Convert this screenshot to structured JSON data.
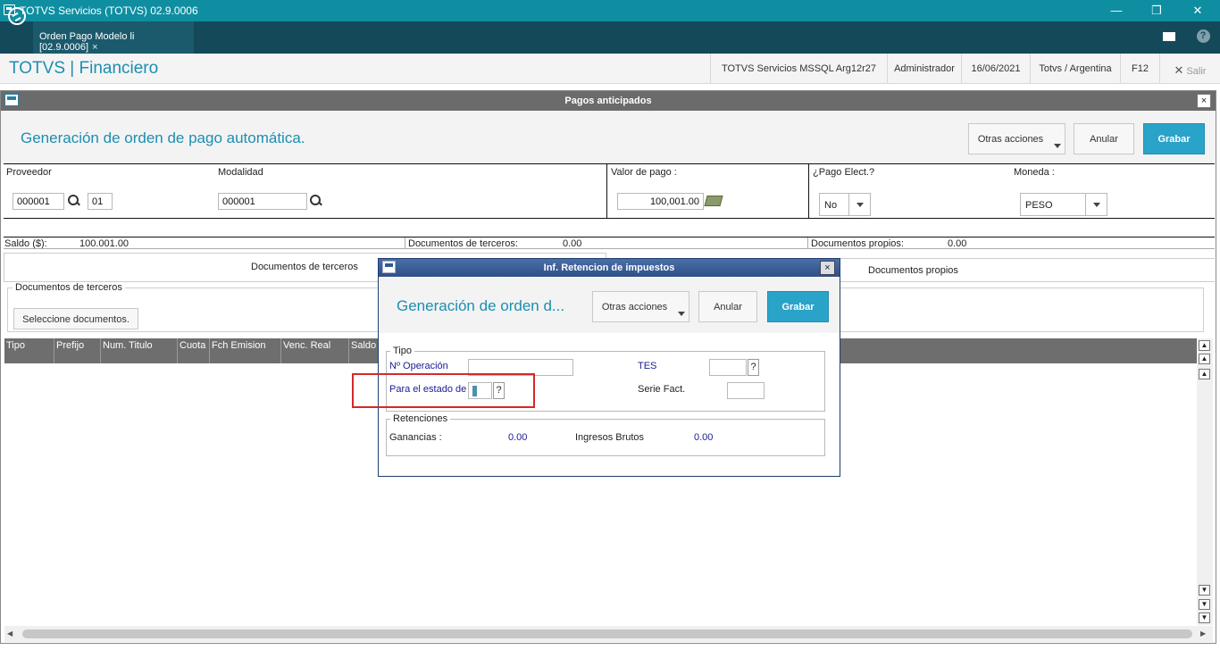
{
  "window": {
    "title": "TOTVS Servicios (TOTVS) 02.9.0006",
    "minimize": "—",
    "restore": "❐",
    "close": "✕"
  },
  "tabbar": {
    "tab_label": "Orden Pago Modelo li [02.9.0006]",
    "tab_close": "×",
    "help": "?"
  },
  "header": {
    "brand": "TOTVS | Financiero",
    "server": "TOTVS Servicios MSSQL Arg12r27",
    "user": "Administrador",
    "date": "16/06/2021",
    "company": "Totvs / Argentina",
    "key": "F12",
    "exit_icon": "✕",
    "exit": "Salir"
  },
  "dialog": {
    "title": "Pagos anticipados",
    "close": "×",
    "heading": "Generación de orden de pago automática.",
    "buttons": {
      "other": "Otras acciones",
      "cancel": "Anular",
      "save": "Grabar"
    }
  },
  "form": {
    "proveedor_label": "Proveedor",
    "proveedor_code": "000001",
    "proveedor_store": "01",
    "modalidad_label": "Modalidad",
    "modalidad_value": "000001",
    "valor_label": "Valor de pago :",
    "valor_value": "100,001.00",
    "pago_elect_label": "¿Pago Elect.?",
    "pago_elect_value": "No",
    "moneda_label": "Moneda :",
    "moneda_value": "PESO"
  },
  "saldo": {
    "saldo_label": "Saldo ($):",
    "saldo_value": "100.001.00",
    "terceros_label": "Documentos de terceros:",
    "terceros_value": "0.00",
    "propios_label": "Documentos propios:",
    "propios_value": "0.00"
  },
  "tabs": {
    "terceros": "Documentos de terceros",
    "propios": "Documentos propios",
    "fieldset_legend": "Documentos de terceros",
    "select_button": "Seleccione documentos."
  },
  "grid": {
    "columns": [
      "Tipo",
      "Prefijo",
      "Num. Titulo",
      "Cuota",
      "Fch Emision",
      "Venc. Real",
      "Saldo"
    ]
  },
  "subdialog": {
    "title": "Inf. Retencion de impuestos",
    "close": "×",
    "heading": "Generación de orden d...",
    "buttons": {
      "other": "Otras acciones",
      "cancel": "Anular",
      "save": "Grabar"
    },
    "tipo_legend": "Tipo",
    "operacion_label": "Nº Operación",
    "operacion_value": "",
    "tes_label": "TES",
    "tes_value": "",
    "estado_label": "Para el estado de",
    "estado_value": "",
    "serie_label": "Serie Fact.",
    "serie_value": "",
    "question": "?",
    "retenciones_legend": "Retenciones",
    "ganancias_label": "Ganancias :",
    "ganancias_value": "0.00",
    "ingresos_label": "Ingresos Brutos",
    "ingresos_value": "0.00"
  }
}
